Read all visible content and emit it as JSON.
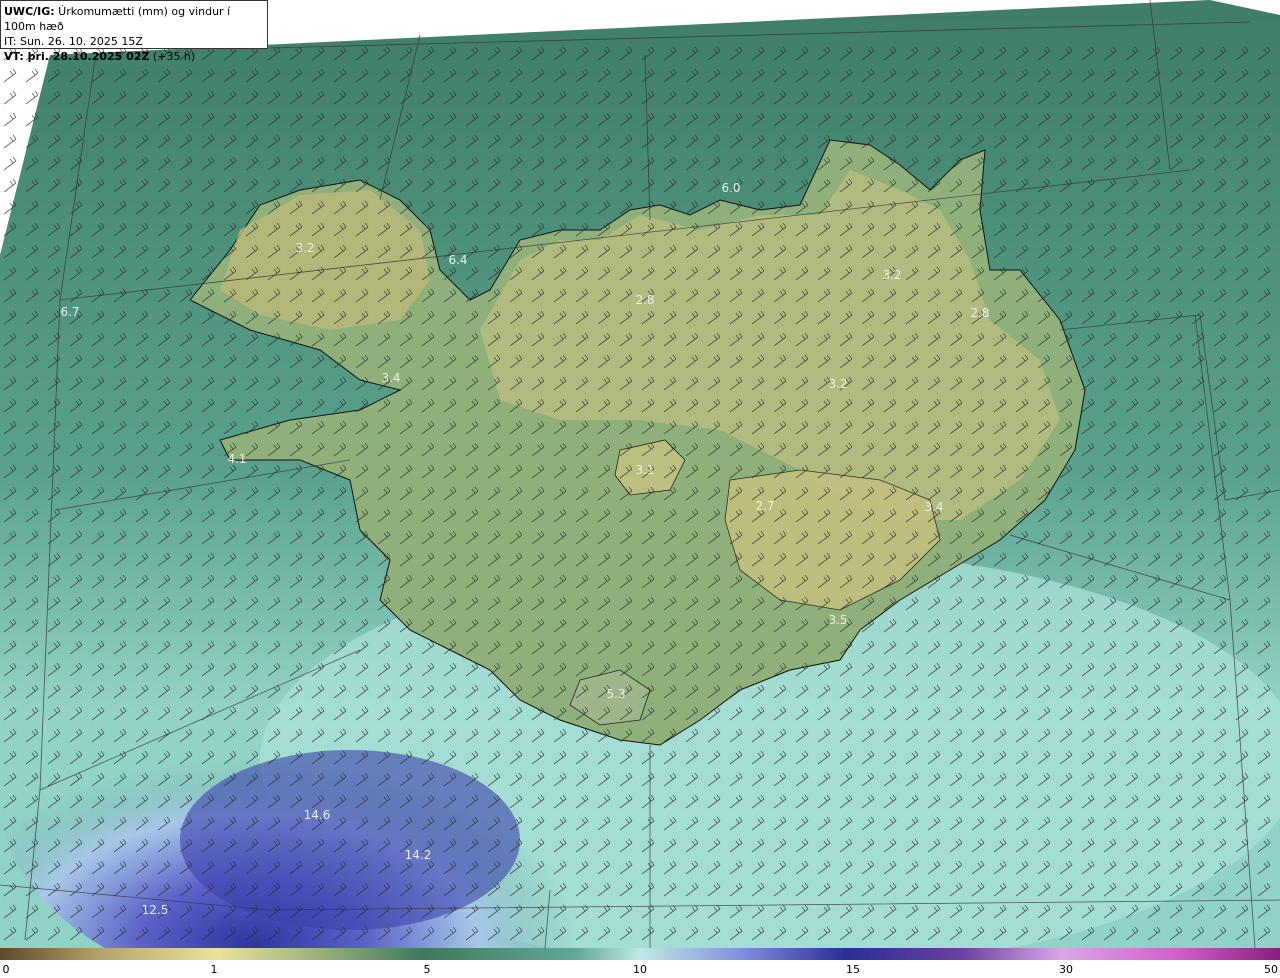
{
  "header": {
    "product": "UWC/IG:",
    "title_rest": " Úrkomumætti (mm) og vindur í 100m hæð",
    "init_time": "IT: Sun. 26. 10. 2025 15Z",
    "valid_prefix": "VT: þri. 28.10.2025 02Z",
    "valid_offset": " (+35 h)"
  },
  "labels": [
    {
      "text": "6.0",
      "name": "value-label-north"
    },
    {
      "text": "3.2",
      "name": "value-label-westfjords"
    },
    {
      "text": "6.4",
      "name": "value-label-westfjords-east"
    },
    {
      "text": "6.7",
      "name": "value-label-west-sea"
    },
    {
      "text": "2.8",
      "name": "value-label-north-central"
    },
    {
      "text": "3.2",
      "name": "value-label-northeast"
    },
    {
      "text": "2.8",
      "name": "value-label-east"
    },
    {
      "text": "3.4",
      "name": "value-label-west"
    },
    {
      "text": "3.2",
      "name": "value-label-highlands"
    },
    {
      "text": "4.1",
      "name": "value-label-reykjanes"
    },
    {
      "text": "3.1",
      "name": "value-label-langjokull"
    },
    {
      "text": "2.7",
      "name": "value-label-vatnajokull"
    },
    {
      "text": "3.4",
      "name": "value-label-southeast"
    },
    {
      "text": "3.5",
      "name": "value-label-southeast-coast"
    },
    {
      "text": "5.3",
      "name": "value-label-myrdalsjokull"
    },
    {
      "text": "14.6",
      "name": "value-label-south-sea-max"
    },
    {
      "text": "14.2",
      "name": "value-label-south-sea"
    },
    {
      "text": "12.5",
      "name": "value-label-southwest-sea"
    }
  ],
  "colorbar": {
    "ticks": [
      "0",
      "1",
      "5",
      "10",
      "15",
      "30",
      "50"
    ]
  },
  "colors": {
    "land_yellow": "#c7c580",
    "land_green": "#6fa07a",
    "sea_green": "#4f8f77",
    "sea_light": "#b7e5df",
    "sea_blue": "#5a5fc7",
    "sea_darkblue": "#3a3fa8"
  }
}
